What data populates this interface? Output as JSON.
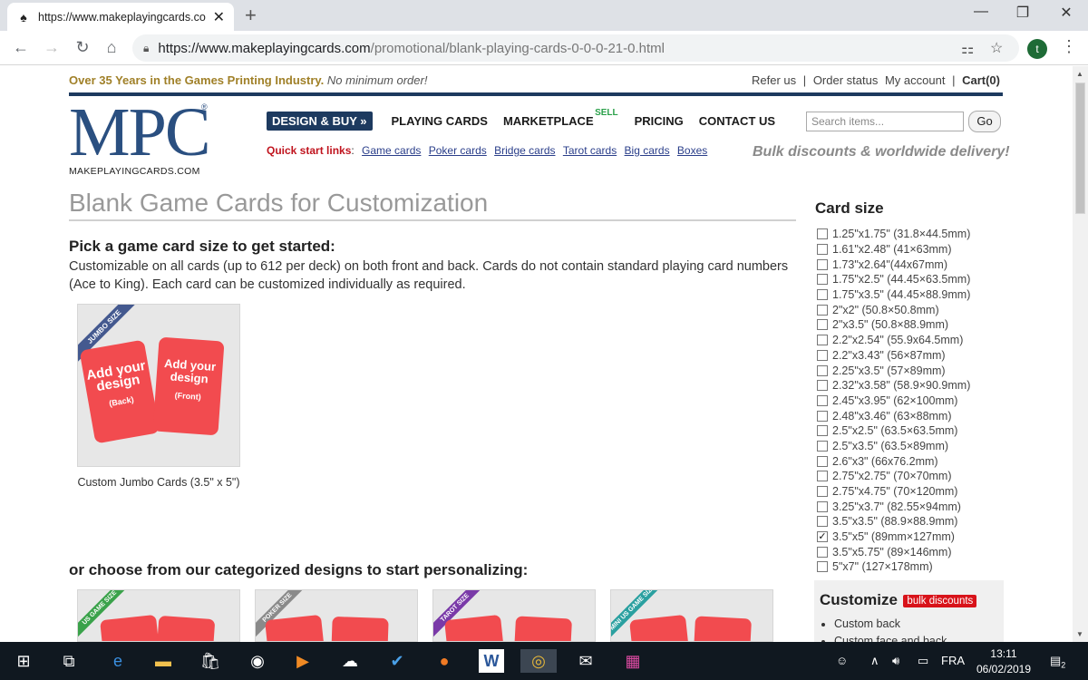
{
  "browser": {
    "tab_title": "https://www.makeplayingcards.co",
    "new_tab": "+",
    "url_host": "https://www.makeplayingcards.com",
    "url_path": "/promotional/blank-playing-cards-0-0-0-21-0.html",
    "avatar_letter": "t"
  },
  "header": {
    "tagline": "Over 35 Years in the Games Printing Industry.",
    "tagline_em": "No minimum order!",
    "links": [
      "Refer us",
      "|",
      "Order status",
      "My account",
      "|"
    ],
    "cart": "Cart(0)",
    "logo_text": "MPC",
    "logo_sub": "MAKEPLAYINGCARDS.COM",
    "logo_reg": "®",
    "nav": {
      "design_buy": "DESIGN & BUY »",
      "playing_cards": "PLAYING CARDS",
      "marketplace": "MARKETPLACE",
      "sell": "SELL",
      "pricing": "PRICING",
      "contact": "CONTACT US"
    },
    "search_placeholder": "Search items...",
    "go": "Go",
    "quick_label": "Quick start links",
    "quick_links": [
      "Game cards",
      "Poker cards",
      "Bridge cards",
      "Tarot cards",
      "Big cards",
      "Boxes"
    ],
    "bulk": "Bulk discounts & worldwide delivery!"
  },
  "main": {
    "title": "Blank Game Cards for Customization",
    "subtitle": "Pick a game card size to get started:",
    "intro": "Customizable on all cards (up to 612 per deck) on both front and back. Cards do not contain standard playing card numbers (Ace to King). Each card can be customized individually as required.",
    "product": {
      "ribbon": "JUMBO SIZE",
      "back_text": "Add your design",
      "back_small": "(Back)",
      "front_text": "Add your design",
      "front_small": "(Front)",
      "caption": "Custom Jumbo Cards (3.5\" x 5\")"
    },
    "categories_heading": "or choose from our categorized designs to start personalizing:",
    "thumbs": [
      {
        "ribbon": "US GAME SIZE",
        "color": "#3aa24a"
      },
      {
        "ribbon": "POKER SIZE",
        "color": "#8a8a8a"
      },
      {
        "ribbon": "TAROT SIZE",
        "color": "#7a3aa8"
      },
      {
        "ribbon": "MINI US GAME SIZE",
        "color": "#2aa0a0"
      }
    ]
  },
  "sidebar": {
    "title": "Card size",
    "sizes": [
      {
        "label": "1.25\"x1.75\" (31.8×44.5mm)",
        "checked": false
      },
      {
        "label": "1.61\"x2.48\" (41×63mm)",
        "checked": false
      },
      {
        "label": "1.73\"x2.64\"(44x67mm)",
        "checked": false
      },
      {
        "label": "1.75\"x2.5\" (44.45×63.5mm)",
        "checked": false
      },
      {
        "label": "1.75\"x3.5\" (44.45×88.9mm)",
        "checked": false
      },
      {
        "label": "2\"x2\" (50.8×50.8mm)",
        "checked": false
      },
      {
        "label": "2\"x3.5\" (50.8×88.9mm)",
        "checked": false
      },
      {
        "label": "2.2\"x2.54\" (55.9x64.5mm)",
        "checked": false
      },
      {
        "label": "2.2\"x3.43\" (56×87mm)",
        "checked": false
      },
      {
        "label": "2.25\"x3.5\" (57×89mm)",
        "checked": false
      },
      {
        "label": "2.32\"x3.58\" (58.9×90.9mm)",
        "checked": false
      },
      {
        "label": "2.45\"x3.95\" (62×100mm)",
        "checked": false
      },
      {
        "label": "2.48\"x3.46\" (63×88mm)",
        "checked": false
      },
      {
        "label": "2.5\"x2.5\" (63.5×63.5mm)",
        "checked": false
      },
      {
        "label": "2.5\"x3.5\" (63.5×89mm)",
        "checked": false
      },
      {
        "label": "2.6\"x3\" (66x76.2mm)",
        "checked": false
      },
      {
        "label": "2.75\"x2.75\" (70×70mm)",
        "checked": false
      },
      {
        "label": "2.75\"x4.75\" (70×120mm)",
        "checked": false
      },
      {
        "label": "3.25\"x3.7\" (82.55×94mm)",
        "checked": false
      },
      {
        "label": "3.5\"x3.5\" (88.9×88.9mm)",
        "checked": false
      },
      {
        "label": "3.5\"x5\" (89mm×127mm)",
        "checked": true
      },
      {
        "label": "3.5\"x5.75\" (89×146mm)",
        "checked": false
      },
      {
        "label": "5\"x7\" (127×178mm)",
        "checked": false
      }
    ],
    "customize_title": "Customize",
    "customize_badge": "bulk discounts",
    "customize_items": [
      "Custom back",
      "Custom face and back"
    ]
  },
  "taskbar": {
    "lang": "FRA",
    "time": "13:11",
    "date": "06/02/2019",
    "notif_count": "2"
  }
}
